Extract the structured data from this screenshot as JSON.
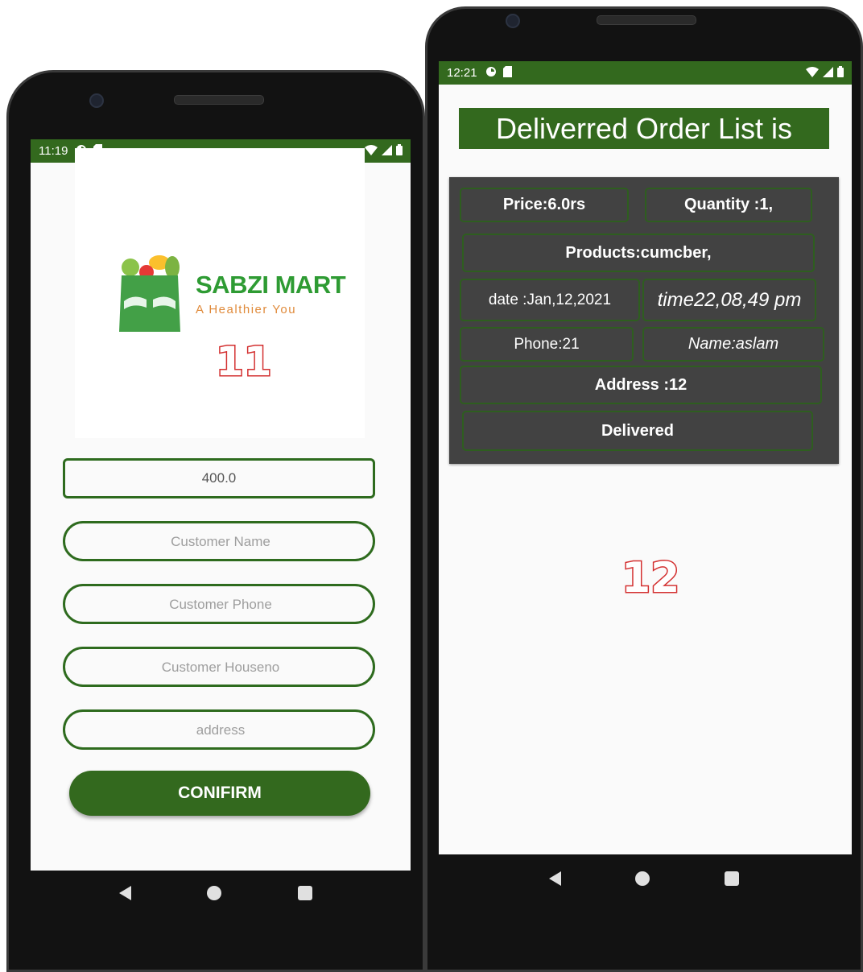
{
  "left_phone": {
    "status_time": "11:19",
    "brand_name": "SABZI MART",
    "brand_tagline": "A Healthier You",
    "screen_number": "11",
    "price_value": "400.0",
    "fields": {
      "name_placeholder": "Customer Name",
      "phone_placeholder": "Customer Phone",
      "houseno_placeholder": "Customer Houseno",
      "address_placeholder": "address"
    },
    "confirm_label": "CONIFIRM"
  },
  "right_phone": {
    "status_time": "12:21",
    "title": "Deliverred Order List is",
    "order": {
      "price": "Price:6.0rs",
      "quantity": "Quantity :1,",
      "products": "Products:cumcber,",
      "date": "date :Jan,12,2021",
      "time": "time22,08,49 pm",
      "phone": "Phone:21",
      "name": "Name:aslam",
      "address": "Address :12",
      "status": "Delivered"
    },
    "screen_number": "12"
  },
  "colors": {
    "primary_green": "#33691e",
    "card_background": "#424242",
    "brand_green": "#2e9b33",
    "tagline_orange": "#e08a3a",
    "number_outline": "#d32f2f"
  }
}
